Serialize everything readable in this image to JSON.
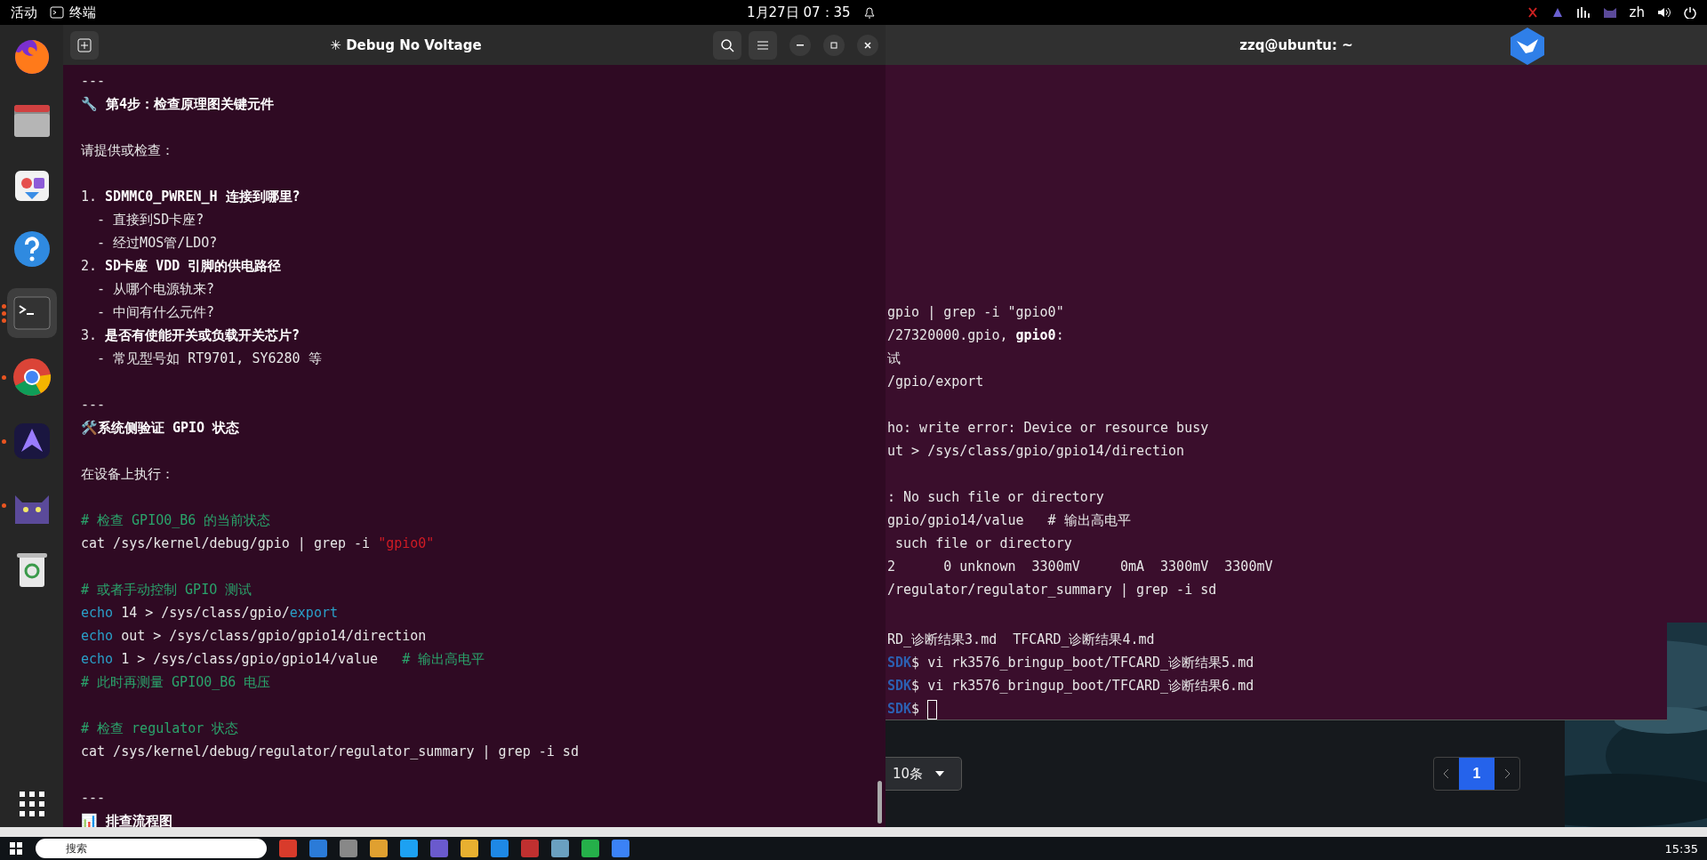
{
  "top_bar": {
    "activities": "活动",
    "app_name": "终端",
    "clock": "1月27日  07：35",
    "input_method": "zh"
  },
  "dock": {
    "items": [
      {
        "kind": "firefox",
        "running": false,
        "selected": false
      },
      {
        "kind": "files",
        "running": false,
        "selected": false
      },
      {
        "kind": "store",
        "running": false,
        "selected": false
      },
      {
        "kind": "help",
        "running": false,
        "selected": false
      },
      {
        "kind": "terminal",
        "running": true,
        "selected": true
      },
      {
        "kind": "chrome",
        "running": true,
        "selected": false
      },
      {
        "kind": "assistant",
        "running": true,
        "selected": false
      },
      {
        "kind": "cat",
        "running": true,
        "selected": false
      },
      {
        "kind": "trash",
        "running": false,
        "selected": false
      }
    ]
  },
  "left_terminal": {
    "title": "✳ Debug No Voltage",
    "lines": [
      {
        "kind": "text",
        "segs": [
          {
            "t": "---",
            "kind": "plain"
          }
        ]
      },
      {
        "kind": "text",
        "segs": [
          {
            "t": "🔧 第4步：检查原理图关键元件",
            "kind": "bold"
          }
        ]
      },
      {
        "kind": "blank"
      },
      {
        "kind": "text",
        "segs": [
          {
            "t": "请提供或检查：",
            "kind": "plain"
          }
        ]
      },
      {
        "kind": "blank"
      },
      {
        "kind": "text",
        "segs": [
          {
            "t": "1. ",
            "kind": "plain"
          },
          {
            "t": "SDMMC0_PWREN_H 连接到哪里?",
            "kind": "bold"
          }
        ]
      },
      {
        "kind": "text",
        "segs": [
          {
            "t": "  - 直接到SD卡座?",
            "kind": "plain"
          }
        ]
      },
      {
        "kind": "text",
        "segs": [
          {
            "t": "  - 经过MOS管/LDO?",
            "kind": "plain"
          }
        ]
      },
      {
        "kind": "text",
        "segs": [
          {
            "t": "2. ",
            "kind": "plain"
          },
          {
            "t": "SD卡座 VDD 引脚的供电路径",
            "kind": "bold"
          }
        ]
      },
      {
        "kind": "text",
        "segs": [
          {
            "t": "  - 从哪个电源轨来?",
            "kind": "plain"
          }
        ]
      },
      {
        "kind": "text",
        "segs": [
          {
            "t": "  - 中间有什么元件?",
            "kind": "plain"
          }
        ]
      },
      {
        "kind": "text",
        "segs": [
          {
            "t": "3. ",
            "kind": "plain"
          },
          {
            "t": "是否有使能开关或负载开关芯片?",
            "kind": "bold"
          }
        ]
      },
      {
        "kind": "text",
        "segs": [
          {
            "t": "  - 常见型号如 RT9701, SY6280 等",
            "kind": "plain"
          }
        ]
      },
      {
        "kind": "blank"
      },
      {
        "kind": "text",
        "segs": [
          {
            "t": "---",
            "kind": "plain"
          }
        ]
      },
      {
        "kind": "text",
        "segs": [
          {
            "t": "🛠️系统侧验证 GPIO 状态",
            "kind": "bold"
          }
        ]
      },
      {
        "kind": "blank"
      },
      {
        "kind": "text",
        "segs": [
          {
            "t": "在设备上执行：",
            "kind": "plain"
          }
        ]
      },
      {
        "kind": "blank"
      },
      {
        "kind": "text",
        "segs": [
          {
            "t": "# 检查 GPIO0_B6 的当前状态",
            "kind": "comment"
          }
        ]
      },
      {
        "kind": "text",
        "segs": [
          {
            "t": "cat /sys/kernel/debug/gpio | grep -i ",
            "kind": "plain"
          },
          {
            "t": "\"gpio0\"",
            "kind": "string"
          }
        ]
      },
      {
        "kind": "blank"
      },
      {
        "kind": "text",
        "segs": [
          {
            "t": "# 或者手动控制 GPIO 测试",
            "kind": "comment"
          }
        ]
      },
      {
        "kind": "text",
        "segs": [
          {
            "t": "echo",
            "kind": "keyword"
          },
          {
            "t": " 14 > /sys/class/gpio/",
            "kind": "plain"
          },
          {
            "t": "export",
            "kind": "keyword"
          }
        ]
      },
      {
        "kind": "text",
        "segs": [
          {
            "t": "echo",
            "kind": "keyword"
          },
          {
            "t": " out > /sys/class/gpio/gpio14/direction",
            "kind": "plain"
          }
        ]
      },
      {
        "kind": "text",
        "segs": [
          {
            "t": "echo",
            "kind": "keyword"
          },
          {
            "t": " 1 > /sys/class/gpio/gpio14/value   ",
            "kind": "plain"
          },
          {
            "t": "# 输出高电平",
            "kind": "comment"
          }
        ]
      },
      {
        "kind": "text",
        "segs": [
          {
            "t": "# 此时再测量 GPIO0_B6 电压",
            "kind": "comment"
          }
        ]
      },
      {
        "kind": "blank"
      },
      {
        "kind": "text",
        "segs": [
          {
            "t": "# 检查 regulator 状态",
            "kind": "comment"
          }
        ]
      },
      {
        "kind": "text",
        "segs": [
          {
            "t": "cat /sys/kernel/debug/regulator/regulator_summary | grep -i sd",
            "kind": "plain"
          }
        ]
      },
      {
        "kind": "blank"
      },
      {
        "kind": "text",
        "segs": [
          {
            "t": "---",
            "kind": "plain"
          }
        ]
      },
      {
        "kind": "text",
        "segs": [
          {
            "t": "📊 排查流程图",
            "kind": "bold"
          }
        ]
      }
    ]
  },
  "right_terminal": {
    "title": "zzq@ubuntu: ~",
    "lines": [
      {
        "kind": "text",
        "segs": [
          {
            "t": "gpio | grep -i \"gpio0\"",
            "kind": "plain"
          }
        ]
      },
      {
        "kind": "text",
        "segs": [
          {
            "t": "/27320000.gpio, ",
            "kind": "plain"
          },
          {
            "t": "gpio0",
            "kind": "bold"
          },
          {
            "t": ":",
            "kind": "plain"
          }
        ]
      },
      {
        "kind": "text",
        "segs": [
          {
            "t": "试",
            "kind": "plain"
          }
        ]
      },
      {
        "kind": "text",
        "segs": [
          {
            "t": "/gpio/export",
            "kind": "plain"
          }
        ]
      },
      {
        "kind": "blank"
      },
      {
        "kind": "text",
        "segs": [
          {
            "t": "ho: write error: Device or resource busy",
            "kind": "plain"
          }
        ]
      },
      {
        "kind": "text",
        "segs": [
          {
            "t": "ut > /sys/class/gpio/gpio14/direction",
            "kind": "plain"
          }
        ]
      },
      {
        "kind": "blank"
      },
      {
        "kind": "text",
        "segs": [
          {
            "t": ": No such file or directory",
            "kind": "plain"
          }
        ]
      },
      {
        "kind": "text",
        "segs": [
          {
            "t": "gpio/gpio14/value   # 输出高电平",
            "kind": "plain"
          }
        ]
      },
      {
        "kind": "text",
        "segs": [
          {
            "t": " such file or directory",
            "kind": "plain"
          }
        ]
      },
      {
        "kind": "text",
        "segs": [
          {
            "t": "2      0 unknown  3300mV     0mA  3300mV  3300mV",
            "kind": "plain"
          }
        ]
      },
      {
        "kind": "text",
        "segs": [
          {
            "t": "/regulator/regulator_summary | grep -i sd",
            "kind": "plain"
          }
        ]
      }
    ]
  },
  "lower_terminal": {
    "lines": [
      {
        "kind": "text",
        "segs": [
          {
            "t": "RD_诊断结果3.md  TFCARD_诊断结果4.md",
            "kind": "plain"
          }
        ]
      },
      {
        "kind": "text",
        "segs": [
          {
            "t": "SDK",
            "kind": "prompt"
          },
          {
            "t": "$ vi rk3576_bringup_boot/TFCARD_诊断结果5.md",
            "kind": "plain"
          }
        ]
      },
      {
        "kind": "text",
        "segs": [
          {
            "t": "SDK",
            "kind": "prompt"
          },
          {
            "t": "$ vi rk3576_bringup_boot/TFCARD_诊断结果6.md",
            "kind": "plain"
          }
        ]
      },
      {
        "kind": "cursor",
        "segs": [
          {
            "t": "SDK",
            "kind": "prompt"
          },
          {
            "t": "$ ",
            "kind": "plain"
          }
        ]
      }
    ]
  },
  "web_panel": {
    "page_size": "10条",
    "pages": [
      {
        "label": "1",
        "selected": true
      }
    ]
  },
  "taskbar": {
    "search": "搜索",
    "clock": "15:35"
  }
}
